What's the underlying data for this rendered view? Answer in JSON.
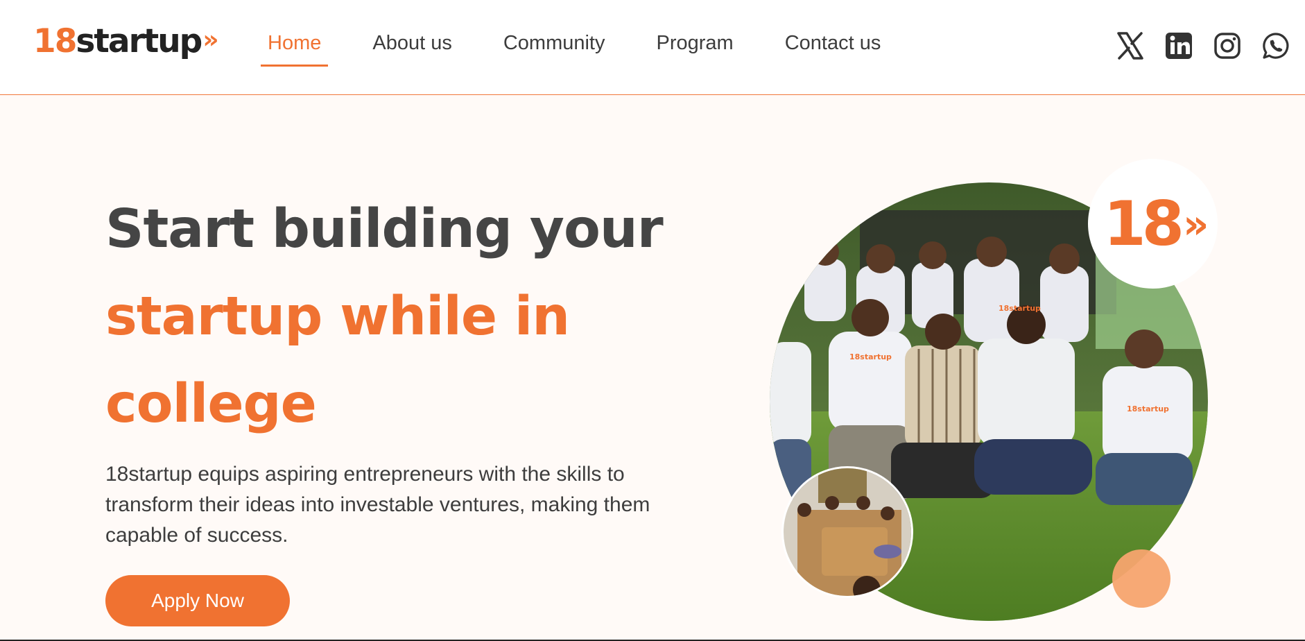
{
  "header": {
    "logo": {
      "num": "18",
      "word": "startup",
      "chevron": "»"
    },
    "nav": [
      {
        "label": "Home",
        "active": true
      },
      {
        "label": "About us",
        "active": false
      },
      {
        "label": "Community",
        "active": false
      },
      {
        "label": "Program",
        "active": false
      },
      {
        "label": "Contact us",
        "active": false
      }
    ],
    "social_icons": [
      "x-icon",
      "linkedin-icon",
      "instagram-icon",
      "whatsapp-icon"
    ]
  },
  "hero": {
    "title_line1": "Start building your",
    "title_line2": "startup while in",
    "title_line3": "college",
    "description": "18startup equips aspiring entrepreneurs with the skills to transform their ideas into investable ventures, making them capable of success.",
    "cta_label": "Apply Now"
  },
  "badge": {
    "num": "18",
    "chevron": "»"
  },
  "colors": {
    "accent": "#f07231",
    "accent_light": "#f7a46e",
    "text_dark": "#454545",
    "background": "#fffaf7"
  }
}
